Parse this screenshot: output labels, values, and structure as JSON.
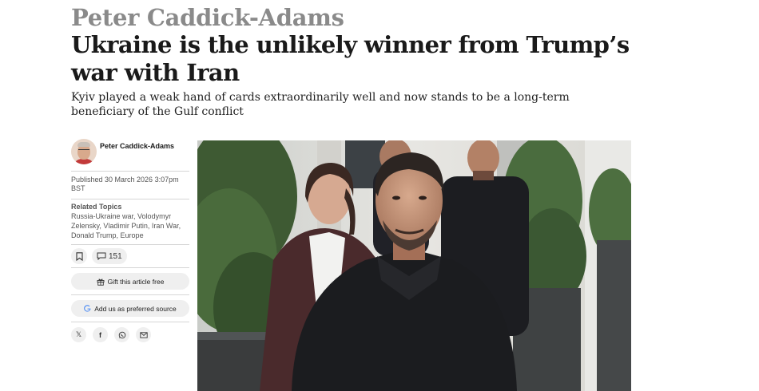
{
  "article": {
    "kicker": "Peter Caddick-Adams",
    "headline": "Ukraine is the unlikely winner from Trump’s war with Iran",
    "standfirst": "Kyiv played a weak hand of cards extraordinarily well and now stands to be a long-term beneficiary of the Gulf conflict"
  },
  "meta": {
    "author_name": "Peter Caddick-Adams",
    "published": "Published 30 March 2026 3:07pm BST",
    "related_title": "Related Topics",
    "related_topics": [
      "Russia-Ukraine war",
      "Volodymyr Zelensky",
      "Vladimir Putin",
      "Iran War",
      "Donald Trump",
      "Europe"
    ],
    "comment_count": "151",
    "gift_label": "Gift this article free",
    "preferred_source_label": "Add us as preferred source"
  },
  "icons": {
    "bookmark": "bookmark-icon",
    "comment": "comment-icon",
    "gift": "gift-icon",
    "google": "google-icon",
    "x": "x-icon",
    "facebook": "facebook-icon",
    "whatsapp": "whatsapp-icon",
    "email": "email-icon"
  },
  "colors": {
    "kicker": "#8a8a8a",
    "headline": "#1a1a1a",
    "pill_bg": "#efefef",
    "google_blue": "#4285F4",
    "google_red": "#EA4335",
    "google_yellow": "#FBBC05",
    "google_green": "#34A853"
  }
}
